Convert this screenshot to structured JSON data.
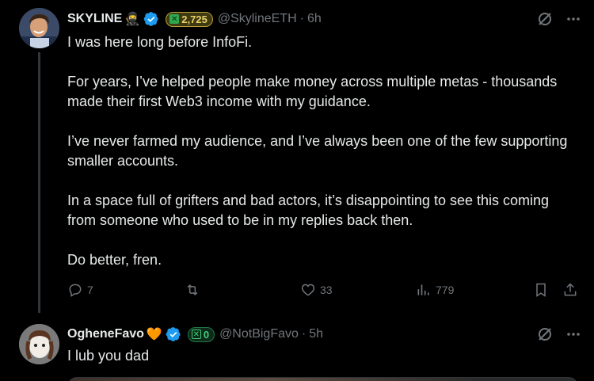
{
  "post1": {
    "name": "SKYLINE",
    "emoji": "🥷",
    "badge_count": "2,725",
    "handle": "@SkylineETH",
    "sep": "·",
    "time": "6h",
    "text": "I was here long before InfoFi.\n\nFor years, I’ve helped people make money across multiple metas - thousands made their first Web3 income with my guidance.\n\nI’ve never farmed my audience, and I’ve always been one of the few supporting smaller accounts.\n\nIn a space full of grifters and bad actors, it’s disappointing to see this coming from someone who used to be in my replies back then.\n\nDo better, fren.",
    "replies": "7",
    "reposts": "",
    "likes": "33",
    "views": "779"
  },
  "post2": {
    "name": "OgheneFavo",
    "emoji": "🧡",
    "badge_count": "0",
    "handle": "@NotBigFavo",
    "sep": "·",
    "time": "5h",
    "text": "I lub you dad"
  },
  "colors": {
    "background": "#000000",
    "text": "#e7e9ea",
    "muted": "#71767b",
    "verified": "#1d9bf0"
  }
}
